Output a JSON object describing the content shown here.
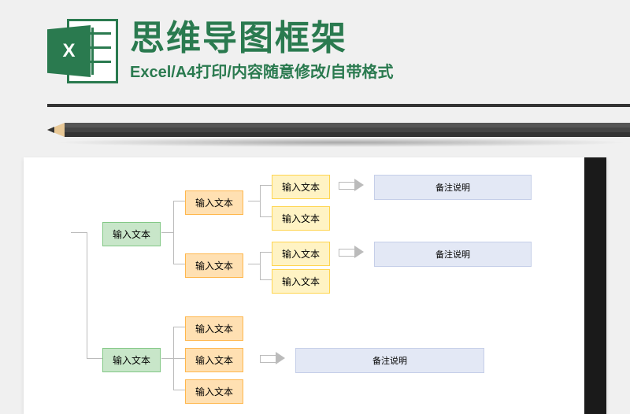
{
  "header": {
    "title": "思维导图框架",
    "subtitle": "Excel/A4打印/内容随意修改/自带格式",
    "icon_letter": "X"
  },
  "diagram": {
    "level1_a": "输入文本",
    "level1_b": "输入文本",
    "level2_a": "输入文本",
    "level2_b": "输入文本",
    "level2_c": "输入文本",
    "level2_d": "输入文本",
    "level2_e": "输入文本",
    "level3_a": "输入文本",
    "level3_b": "输入文本",
    "level3_c": "输入文本",
    "level3_d": "输入文本",
    "note_a": "备注说明",
    "note_b": "备注说明",
    "note_c": "备注说明"
  }
}
